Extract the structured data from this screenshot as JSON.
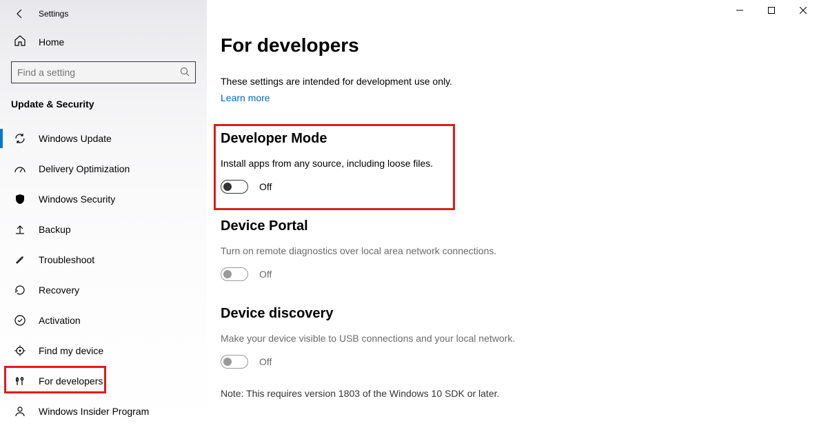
{
  "app_title": "Settings",
  "window": {
    "min": "−",
    "max": "□",
    "close": "✕"
  },
  "home_label": "Home",
  "search_placeholder": "Find a setting",
  "sidebar_section": "Update & Security",
  "nav_items": [
    {
      "label": "Windows Update"
    },
    {
      "label": "Delivery Optimization"
    },
    {
      "label": "Windows Security"
    },
    {
      "label": "Backup"
    },
    {
      "label": "Troubleshoot"
    },
    {
      "label": "Recovery"
    },
    {
      "label": "Activation"
    },
    {
      "label": "Find my device"
    },
    {
      "label": "For developers"
    },
    {
      "label": "Windows Insider Program"
    }
  ],
  "page": {
    "title": "For developers",
    "intro": "These settings are intended for development use only.",
    "learn_more": "Learn more"
  },
  "sections": {
    "dev_mode": {
      "heading": "Developer Mode",
      "desc": "Install apps from any source, including loose files.",
      "toggle_state": "Off"
    },
    "device_portal": {
      "heading": "Device Portal",
      "desc": "Turn on remote diagnostics over local area network connections.",
      "toggle_state": "Off"
    },
    "device_discovery": {
      "heading": "Device discovery",
      "desc": "Make your device visible to USB connections and your local network.",
      "toggle_state": "Off",
      "note": "Note: This requires version 1803 of the Windows 10 SDK or later."
    }
  }
}
